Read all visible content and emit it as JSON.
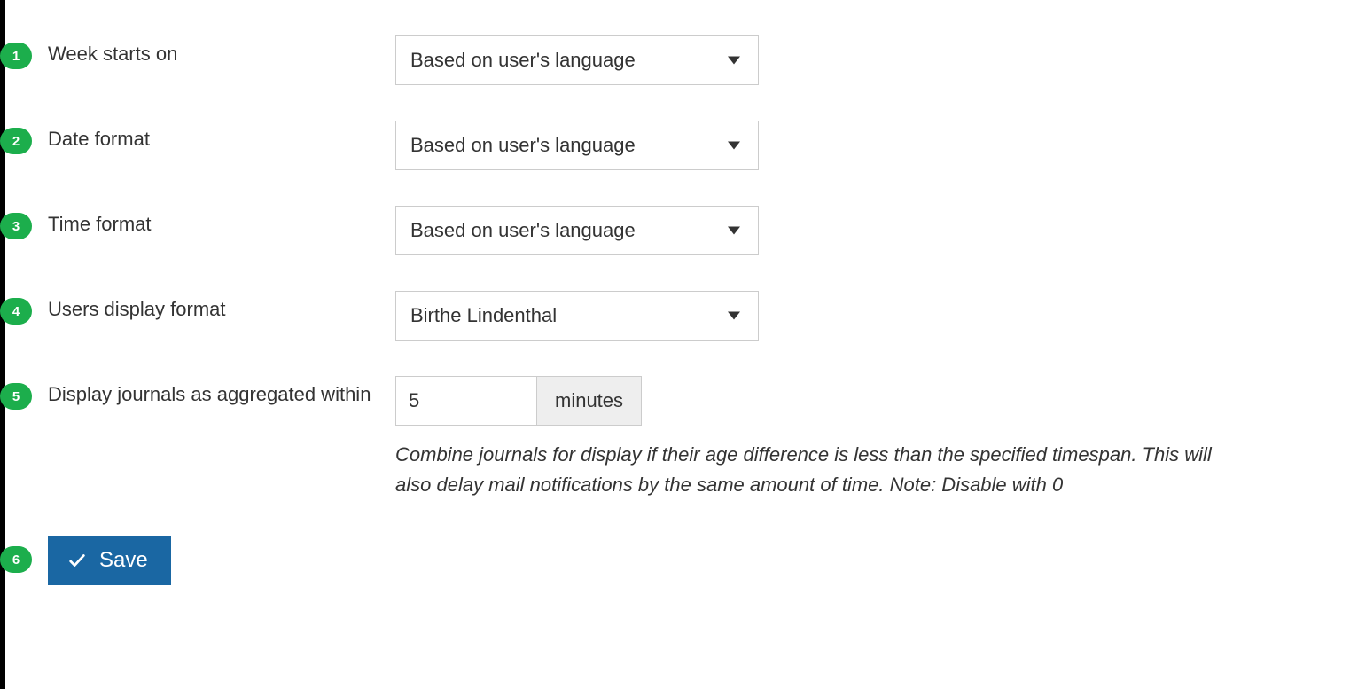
{
  "badges": [
    "1",
    "2",
    "3",
    "4",
    "5",
    "6"
  ],
  "fields": {
    "week_starts": {
      "label": "Week starts on",
      "value": "Based on user's language"
    },
    "date_format": {
      "label": "Date format",
      "value": "Based on user's language"
    },
    "time_format": {
      "label": "Time format",
      "value": "Based on user's language"
    },
    "users_display_format": {
      "label": "Users display format",
      "value": "Birthe Lindenthal"
    },
    "journals_aggregated": {
      "label": "Display journals as aggregated within",
      "value": "5",
      "unit": "minutes",
      "help": "Combine journals for display if their age difference is less than the specified timespan. This will also delay mail notifications by the same amount of time. Note: Disable with 0"
    }
  },
  "actions": {
    "save": "Save"
  }
}
